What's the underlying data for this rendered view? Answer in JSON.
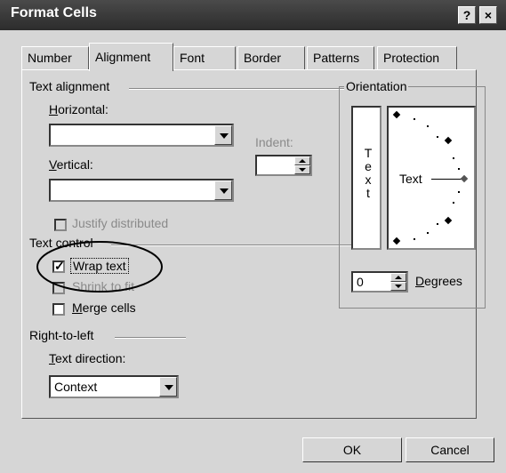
{
  "window": {
    "title": "Format Cells",
    "help_label": "?",
    "close_label": "×"
  },
  "tabs": [
    {
      "label": "Number"
    },
    {
      "label": "Alignment"
    },
    {
      "label": "Font"
    },
    {
      "label": "Border"
    },
    {
      "label": "Patterns"
    },
    {
      "label": "Protection"
    }
  ],
  "text_alignment": {
    "group_label": "Text alignment",
    "horizontal_label": "Horizontal:",
    "horizontal_value": "",
    "vertical_label": "Vertical:",
    "vertical_value": "",
    "indent_label": "Indent:",
    "indent_value": "",
    "justify_distributed_label": "Justify distributed"
  },
  "orientation": {
    "group_label": "Orientation",
    "vertical_text": [
      "T",
      "e",
      "x",
      "t"
    ],
    "dial_text": "Text",
    "degrees_value": "0",
    "degrees_label": "Degrees"
  },
  "text_control": {
    "group_label": "Text control",
    "wrap_text_label": "Wrap text",
    "wrap_text_checked": true,
    "shrink_to_fit_label": "Shrink to fit",
    "merge_cells_label": "Merge cells"
  },
  "right_to_left": {
    "group_label": "Right-to-left",
    "text_direction_label": "Text direction:",
    "text_direction_value": "Context"
  },
  "buttons": {
    "ok_label": "OK",
    "cancel_label": "Cancel"
  },
  "colors": {
    "face": "#d6d6d6",
    "titlebar": "#3a3a3a"
  }
}
